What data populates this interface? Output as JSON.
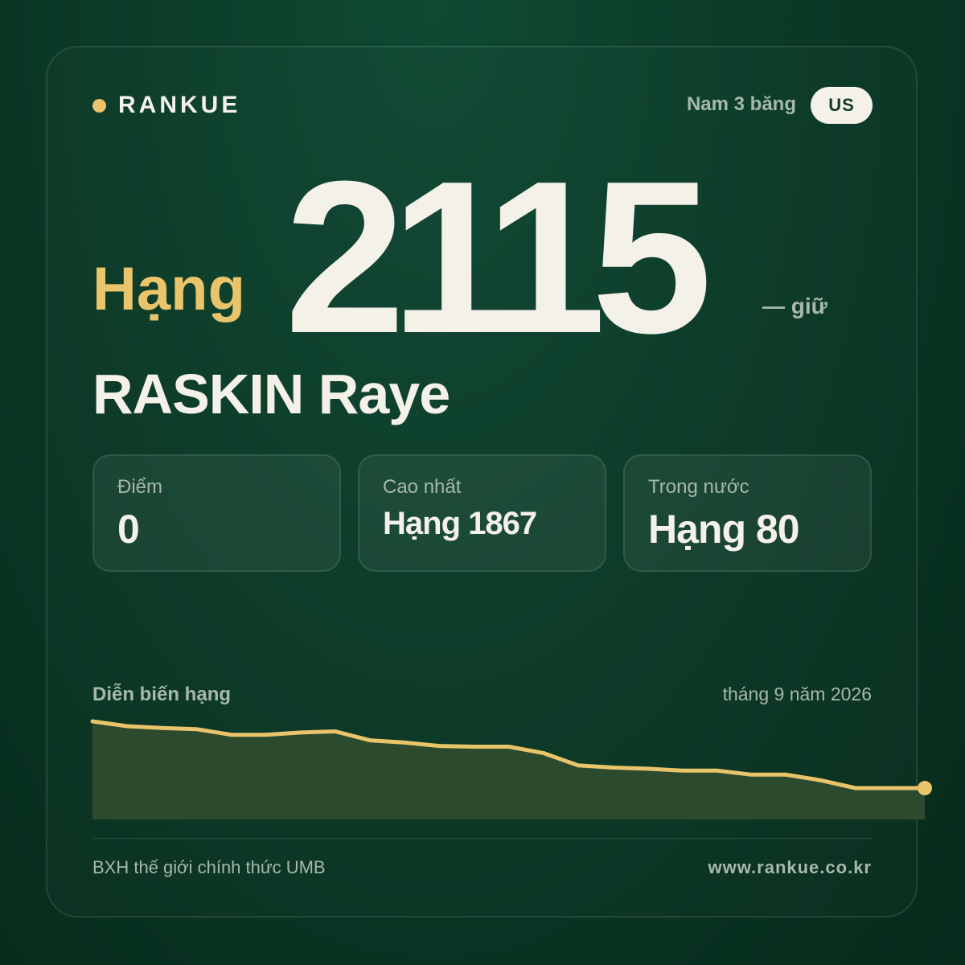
{
  "brand": {
    "name": "RANKUE"
  },
  "header": {
    "division": "Nam 3 băng",
    "country_code": "US"
  },
  "rank": {
    "label": "Hạng",
    "value": "2115",
    "change": "— giữ"
  },
  "player": {
    "name": "RASKIN Raye"
  },
  "stats": [
    {
      "label": "Điểm",
      "value": "0"
    },
    {
      "label": "Cao nhất",
      "value": "Hạng 1867"
    },
    {
      "label": "Trong nước",
      "value": "Hạng 80"
    }
  ],
  "chart": {
    "title": "Diễn biến hạng",
    "date": "tháng 9 năm 2026"
  },
  "chart_data": {
    "type": "area",
    "values": [
      1867,
      1880,
      1885,
      1888,
      1903,
      1903,
      1897,
      1894,
      1918,
      1924,
      1933,
      1935,
      1935,
      1952,
      1985,
      1991,
      1994,
      1999,
      1999,
      2010,
      2010,
      2025,
      2046,
      2046,
      2046
    ],
    "ylim": [
      1867,
      2115
    ],
    "y_inverted": true,
    "grid": false,
    "line_color": "#e9c46a",
    "fill_color": "#2c4a2e"
  },
  "footer": {
    "source": "BXH thế giới chính thức UMB",
    "website": "www.rankue.co.kr"
  },
  "colors": {
    "accent": "#e9c46a",
    "text": "#f4f1e8",
    "muted": "#a7b8ad"
  }
}
